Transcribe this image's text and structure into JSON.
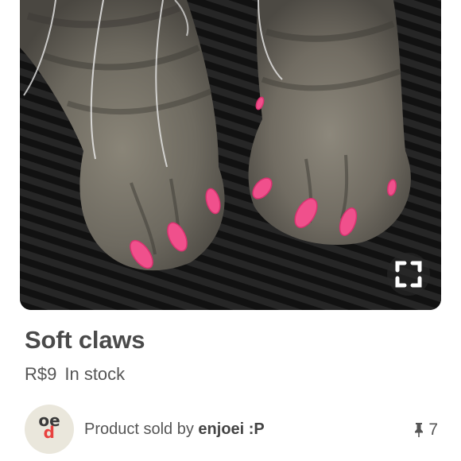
{
  "product": {
    "title": "Soft claws",
    "price": "R$9",
    "stock_status": "In stock"
  },
  "seller": {
    "prefix": "Product sold by",
    "name": "enjoei :P",
    "avatar_text_top": "oe",
    "avatar_text_bottom": "p"
  },
  "pins": {
    "count": "7",
    "icon": "pushpin-icon"
  },
  "image": {
    "icon": "expand-icon",
    "accent_color": "#f0508c"
  }
}
